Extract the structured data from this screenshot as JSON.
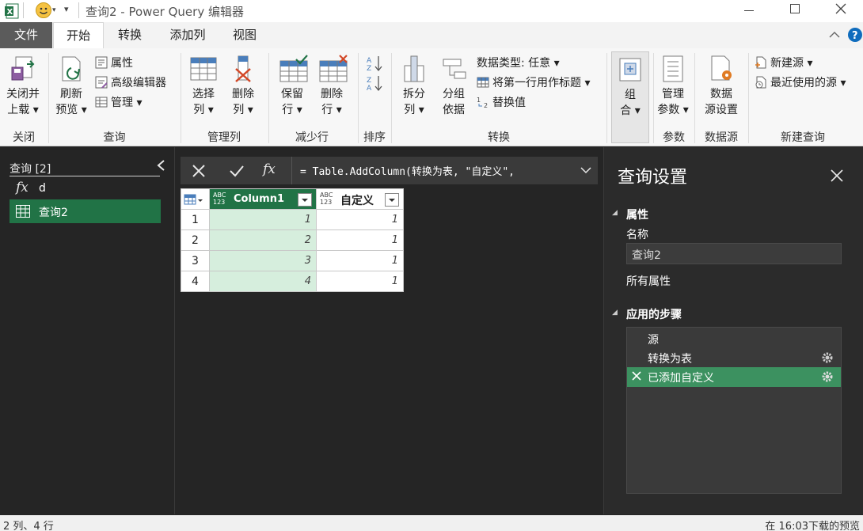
{
  "window": {
    "title": "查询2 - Power Query 编辑器",
    "app_icon": "excel-icon",
    "smiley_icon": "smiley-feedback-icon"
  },
  "tabs": [
    {
      "label": "文件"
    },
    {
      "label": "开始"
    },
    {
      "label": "转换"
    },
    {
      "label": "添加列"
    },
    {
      "label": "视图"
    }
  ],
  "ribbon": {
    "close": {
      "btn_line1": "关闭并",
      "btn_line2": "上载",
      "group": "关闭"
    },
    "query": {
      "refresh_line1": "刷新",
      "refresh_line2": "预览",
      "properties": "属性",
      "advanced_editor": "高级编辑器",
      "manage": "管理",
      "group": "查询"
    },
    "manage_columns": {
      "choose_line1": "选择",
      "choose_line2": "列",
      "remove_line1": "删除",
      "remove_line2": "列",
      "group": "管理列"
    },
    "reduce_rows": {
      "keep_line1": "保留",
      "keep_line2": "行",
      "remove_line1": "删除",
      "remove_line2": "行",
      "group": "减少行"
    },
    "sort": {
      "group": "排序"
    },
    "transform": {
      "split_line1": "拆分",
      "split_line2": "列",
      "group_line1": "分组",
      "group_line2": "依据",
      "data_type": "数据类型: 任意",
      "first_row_header": "将第一行用作标题",
      "replace_values": "替换值",
      "group": "转换"
    },
    "combine": {
      "line1": "组",
      "line2": "合"
    },
    "parameters": {
      "line1": "管理",
      "line2": "参数",
      "group": "参数"
    },
    "data_source": {
      "line1": "数据",
      "line2": "源设置",
      "group": "数据源"
    },
    "new_query": {
      "new_source": "新建源",
      "recent_sources": "最近使用的源",
      "group": "新建查询"
    }
  },
  "queries_pane": {
    "header": "查询 [2]",
    "items": [
      {
        "label": "d",
        "icon": "function-icon"
      },
      {
        "label": "查询2",
        "icon": "table-icon"
      }
    ]
  },
  "formula_bar": {
    "text": "= Table.AddColumn(转换为表, \"自定义\","
  },
  "grid": {
    "columns": [
      {
        "type": "ABC\n123",
        "name": "Column1"
      },
      {
        "type": "ABC\n123",
        "name": "自定义"
      }
    ],
    "rows": [
      {
        "n": "1",
        "c1": "1",
        "c2": "1"
      },
      {
        "n": "2",
        "c1": "2",
        "c2": "1"
      },
      {
        "n": "3",
        "c1": "3",
        "c2": "1"
      },
      {
        "n": "4",
        "c1": "4",
        "c2": "1"
      }
    ]
  },
  "settings": {
    "title": "查询设置",
    "properties_header": "属性",
    "name_label": "名称",
    "name_value": "查询2",
    "all_properties": "所有属性",
    "steps_header": "应用的步骤",
    "steps": [
      {
        "label": "源"
      },
      {
        "label": "转换为表"
      },
      {
        "label": "已添加自定义"
      }
    ]
  },
  "status": {
    "left": "2 列、4 行",
    "right": "在 16:03下载的预览"
  },
  "colors": {
    "accent_green": "#217346",
    "selected_green": "#3c9160",
    "column_highlight": "#d6eedd",
    "help_blue": "#0f6cbd"
  }
}
